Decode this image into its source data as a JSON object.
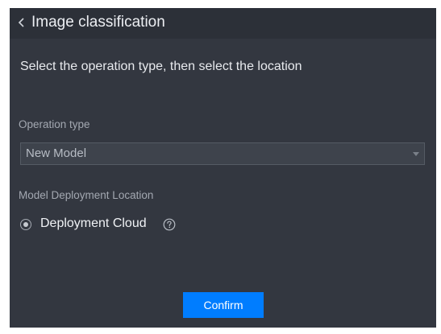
{
  "header": {
    "title": "Image classification"
  },
  "instruction": "Select the operation type, then select the location",
  "operation_type": {
    "label": "Operation type",
    "selected_value": "New Model"
  },
  "deployment_location": {
    "label": "Model Deployment Location",
    "options": [
      {
        "label": "Deployment Cloud",
        "selected": true
      }
    ]
  },
  "confirm_label": "Confirm",
  "icons": {
    "back": "chevron-left-icon",
    "help": "question-circle-icon",
    "dropdown": "caret-down-icon"
  },
  "colors": {
    "panel_background": "#333740",
    "header_background": "#2c3038",
    "accent": "#007dff",
    "text_primary": "#eceef2",
    "text_secondary": "#a3a8b1"
  }
}
